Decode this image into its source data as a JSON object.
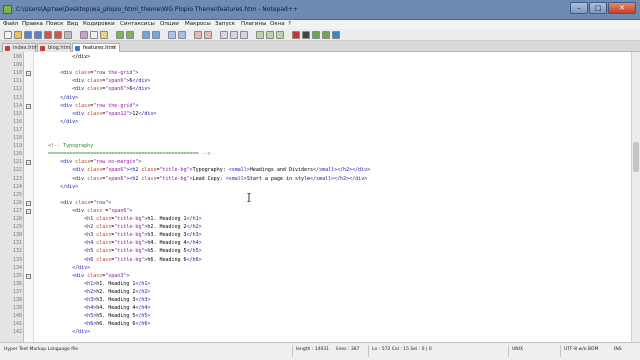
{
  "window": {
    "title": "C:\\Users\\Артем\\Desktop\\wa_plopio_html_theme\\WG Plopio Theme\\features.htm - Notepad++",
    "minimize_label": "–",
    "maximize_label": "□",
    "close_label": "✕"
  },
  "menu": [
    "Файл",
    "Правка",
    "Поиск",
    "Вид",
    "Кодировки",
    "Синтаксисы",
    "Опции",
    "Макросы",
    "Запуск",
    "Плагины",
    "Окна",
    "?"
  ],
  "tabs": [
    {
      "label": "index.html",
      "active": false
    },
    {
      "label": "blog.htm",
      "active": false
    },
    {
      "label": "features.htm",
      "active": true
    }
  ],
  "editor": {
    "lines": [
      {
        "n": "108",
        "fold": false,
        "html": "            &lt;/div&gt;"
      },
      {
        "n": "109",
        "fold": false,
        "html": ""
      },
      {
        "n": "110",
        "fold": true,
        "html": "        <span class=\"tag\">&lt;div</span> <span class=\"attr\">class</span>=<span class=\"str\">\"row the-grid\"</span><span class=\"tag\">&gt;</span>"
      },
      {
        "n": "111",
        "fold": false,
        "html": "            <span class=\"tag\">&lt;div</span> <span class=\"attr\">class</span>=<span class=\"str\">\"span6\"</span><span class=\"tag\">&gt;</span>6<span class=\"tag\">&lt;/div&gt;</span>"
      },
      {
        "n": "112",
        "fold": false,
        "html": "            <span class=\"tag\">&lt;div</span> <span class=\"attr\">class</span>=<span class=\"str\">\"span6\"</span><span class=\"tag\">&gt;</span>6<span class=\"tag\">&lt;/div&gt;</span>"
      },
      {
        "n": "113",
        "fold": false,
        "html": "        <span class=\"tag\">&lt;/div&gt;</span>"
      },
      {
        "n": "114",
        "fold": true,
        "html": "        <span class=\"tag\">&lt;div</span> <span class=\"attr\">class</span>=<span class=\"str\">\"row the-grid\"</span><span class=\"tag\">&gt;</span>"
      },
      {
        "n": "115",
        "fold": false,
        "html": "            <span class=\"tag\">&lt;div</span> <span class=\"attr\">class</span>=<span class=\"str\">\"span12\"</span><span class=\"tag\">&gt;</span>12<span class=\"tag\">&lt;/div&gt;</span>"
      },
      {
        "n": "116",
        "fold": false,
        "html": "        <span class=\"tag\">&lt;/div&gt;</span>"
      },
      {
        "n": "117",
        "fold": false,
        "html": ""
      },
      {
        "n": "118",
        "fold": false,
        "html": ""
      },
      {
        "n": "119",
        "fold": false,
        "html": "    <span class=\"cmt\">&lt;!-- Typography</span>"
      },
      {
        "n": "120",
        "fold": false,
        "html": "    <span class=\"cmt\">================================================== --&gt;</span>"
      },
      {
        "n": "121",
        "fold": true,
        "html": "        <span class=\"tag\">&lt;div</span> <span class=\"attr\">class</span>=<span class=\"str\">\"row no-margin\"</span><span class=\"tag\">&gt;</span>"
      },
      {
        "n": "122",
        "fold": false,
        "html": "            <span class=\"tag\">&lt;div</span> <span class=\"attr\">class</span>=<span class=\"str\">\"span6\"</span><span class=\"tag\">&gt;&lt;h2</span> <span class=\"attr\">class</span>=<span class=\"str\">\"title-bg\"</span><span class=\"tag\">&gt;</span>Typography: <span class=\"tag\">&lt;small&gt;</span>Headings and Dividers<span class=\"tag\">&lt;/small&gt;&lt;/h2&gt;&lt;/div&gt;</span>"
      },
      {
        "n": "123",
        "fold": false,
        "html": "            <span class=\"tag\">&lt;div</span> <span class=\"attr\">class</span>=<span class=\"str\">\"span6\"</span><span class=\"tag\">&gt;&lt;h2</span> <span class=\"attr\">class</span>=<span class=\"str\">\"title-bg\"</span><span class=\"tag\">&gt;</span>Lead Copy: <span class=\"tag\">&lt;small&gt;</span>Start a page in style<span class=\"tag\">&lt;/small&gt;&lt;/h2&gt;&lt;/div&gt;</span>"
      },
      {
        "n": "124",
        "fold": false,
        "html": "        <span class=\"tag\">&lt;/div&gt;</span>"
      },
      {
        "n": "125",
        "fold": false,
        "html": ""
      },
      {
        "n": "126",
        "fold": true,
        "html": "        <span class=\"tag\">&lt;div</span> <span class=\"attr\">class</span>=<span class=\"str\">\"row\"</span><span class=\"tag\">&gt;</span>"
      },
      {
        "n": "127",
        "fold": true,
        "html": "            <span class=\"tag\">&lt;div</span> <span class=\"attr\">class</span> =<span class=\"str\">\"span6\"</span><span class=\"tag\">&gt;</span>"
      },
      {
        "n": "128",
        "fold": false,
        "html": "                <span class=\"tag\">&lt;h1</span> <span class=\"attr\">class</span>=<span class=\"str\">\"title-bg\"</span><span class=\"tag\">&gt;</span>h1. Heading 1<span class=\"tag\">&lt;/h1&gt;</span>"
      },
      {
        "n": "129",
        "fold": false,
        "html": "                <span class=\"tag\">&lt;h2</span> <span class=\"attr\">class</span>=<span class=\"str\">\"title-bg\"</span><span class=\"tag\">&gt;</span>h2. Heading 2<span class=\"tag\">&lt;/h2&gt;</span>"
      },
      {
        "n": "130",
        "fold": false,
        "html": "                <span class=\"tag\">&lt;h3</span> <span class=\"attr\">class</span>=<span class=\"str\">\"title-bg\"</span><span class=\"tag\">&gt;</span>h3. Heading 3<span class=\"tag\">&lt;/h3&gt;</span>"
      },
      {
        "n": "131",
        "fold": false,
        "html": "                <span class=\"tag\">&lt;h4</span> <span class=\"attr\">class</span>=<span class=\"str\">\"title-bg\"</span><span class=\"tag\">&gt;</span>h4. Heading 4<span class=\"tag\">&lt;/h4&gt;</span>"
      },
      {
        "n": "132",
        "fold": false,
        "html": "                <span class=\"tag\">&lt;h5</span> <span class=\"attr\">class</span>=<span class=\"str\">\"title-bg\"</span><span class=\"tag\">&gt;</span>h5. Heading 5<span class=\"tag\">&lt;/h5&gt;</span>"
      },
      {
        "n": "133",
        "fold": false,
        "html": "                <span class=\"tag\">&lt;h6</span> <span class=\"attr\">class</span>=<span class=\"str\">\"title-bg\"</span><span class=\"tag\">&gt;</span>h6. Heading 6<span class=\"tag\">&lt;/h6&gt;</span>"
      },
      {
        "n": "134",
        "fold": false,
        "html": "            <span class=\"tag\">&lt;/div&gt;</span>"
      },
      {
        "n": "135",
        "fold": true,
        "html": "            <span class=\"tag\">&lt;div</span> <span class=\"attr\">class</span>=<span class=\"str\">\"span3\"</span><span class=\"tag\">&gt;</span>"
      },
      {
        "n": "136",
        "fold": false,
        "html": "                <span class=\"tag\">&lt;h1&gt;</span>h1. Heading 1<span class=\"tag\">&lt;/h1&gt;</span>"
      },
      {
        "n": "137",
        "fold": false,
        "html": "                <span class=\"tag\">&lt;h2&gt;</span>h2. Heading 2<span class=\"tag\">&lt;/h2&gt;</span>"
      },
      {
        "n": "138",
        "fold": false,
        "html": "                <span class=\"tag\">&lt;h3&gt;</span>h3. Heading 3<span class=\"tag\">&lt;/h3&gt;</span>"
      },
      {
        "n": "139",
        "fold": false,
        "html": "                <span class=\"tag\">&lt;h4&gt;</span>h4. Heading 4<span class=\"tag\">&lt;/h4&gt;</span>"
      },
      {
        "n": "140",
        "fold": false,
        "html": "                <span class=\"tag\">&lt;h5&gt;</span>h5. Heading 5<span class=\"tag\">&lt;/h5&gt;</span>"
      },
      {
        "n": "141",
        "fold": false,
        "html": "                <span class=\"tag\">&lt;h6&gt;</span>h6. Heading 6<span class=\"tag\">&lt;/h6&gt;</span>"
      },
      {
        "n": "142",
        "fold": false,
        "html": "            <span class=\"tag\">&lt;/div&gt;</span>"
      }
    ]
  },
  "status": {
    "language": "Hyper Text Markup Language file",
    "length": "length : 14031",
    "lines": "lines : 387",
    "position": "Ln : 572    Col : 15    Sel : 0 | 0",
    "eol": "UNIX",
    "encoding": "UTF-8 w/o BOM",
    "mode": "INS"
  }
}
